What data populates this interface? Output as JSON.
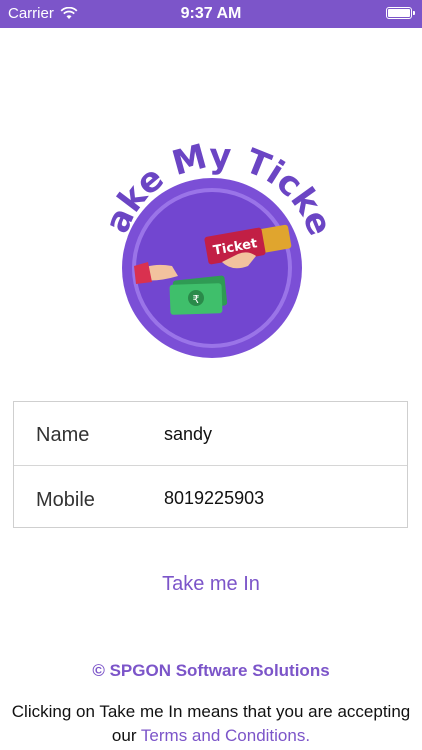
{
  "status_bar": {
    "carrier": "Carrier",
    "time": "9:37 AM",
    "icons": [
      "wifi-icon",
      "battery-icon"
    ]
  },
  "logo": {
    "title": "Take My Ticket",
    "ticket_label": "Ticket",
    "currency_symbol": "₹"
  },
  "form": {
    "name_label": "Name",
    "name_value": "sandy",
    "mobile_label": "Mobile",
    "mobile_value": "8019225903"
  },
  "actions": {
    "take_me_in_label": "Take me In"
  },
  "footer": {
    "copyright": "© SPGON Software Solutions",
    "disclaimer_text": "Clicking on Take me In means that you are accepting our",
    "terms_link": "Terms and Conditions."
  },
  "colors": {
    "accent": "#7c55c9",
    "logo_circle": "#7b4fd6",
    "ticket_red": "#c21f45",
    "money_green": "#34a853"
  }
}
